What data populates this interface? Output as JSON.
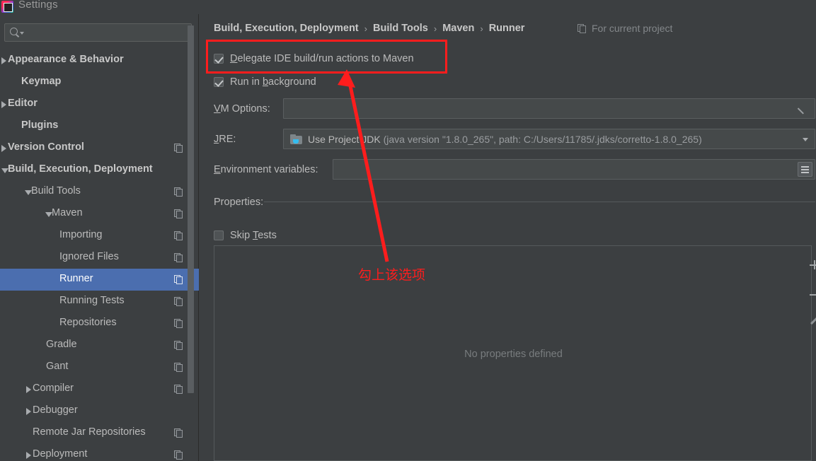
{
  "window": {
    "title": "Settings",
    "logo_icon": "intellij-idea-logo-icon"
  },
  "sidebar": {
    "search": {
      "value": "",
      "placeholder": "",
      "icon": "search-icon",
      "caret_icon": "chevron-down-icon"
    },
    "items": [
      {
        "label": "Appearance & Behavior",
        "indent": 11,
        "arrow": "right",
        "bold": true,
        "copy": false
      },
      {
        "label": "Keymap",
        "indent": 30,
        "arrow": "none",
        "bold": true,
        "copy": false
      },
      {
        "label": "Editor",
        "indent": 11,
        "arrow": "right",
        "bold": true,
        "copy": false
      },
      {
        "label": "Plugins",
        "indent": 30,
        "arrow": "none",
        "bold": true,
        "copy": false
      },
      {
        "label": "Version Control",
        "indent": 11,
        "arrow": "right",
        "bold": true,
        "copy": true
      },
      {
        "label": "Build, Execution, Deployment",
        "indent": 11,
        "arrow": "down",
        "bold": true,
        "copy": false
      },
      {
        "label": "Build Tools",
        "indent": 44,
        "arrow": "down",
        "bold": false,
        "copy": true
      },
      {
        "label": "Maven",
        "indent": 73,
        "arrow": "down",
        "bold": false,
        "copy": true
      },
      {
        "label": "Importing",
        "indent": 84,
        "arrow": "none",
        "bold": false,
        "copy": true
      },
      {
        "label": "Ignored Files",
        "indent": 84,
        "arrow": "none",
        "bold": false,
        "copy": true
      },
      {
        "label": "Runner",
        "indent": 84,
        "arrow": "none",
        "bold": false,
        "copy": true,
        "selected": true
      },
      {
        "label": "Running Tests",
        "indent": 84,
        "arrow": "none",
        "bold": false,
        "copy": true
      },
      {
        "label": "Repositories",
        "indent": 84,
        "arrow": "none",
        "bold": false,
        "copy": true
      },
      {
        "label": "Gradle",
        "indent": 65,
        "arrow": "none",
        "bold": false,
        "copy": true
      },
      {
        "label": "Gant",
        "indent": 65,
        "arrow": "none",
        "bold": false,
        "copy": true
      },
      {
        "label": "Compiler",
        "indent": 46,
        "arrow": "right",
        "bold": false,
        "copy": true
      },
      {
        "label": "Debugger",
        "indent": 46,
        "arrow": "right",
        "bold": false,
        "copy": false
      },
      {
        "label": "Remote Jar Repositories",
        "indent": 46,
        "arrow": "none",
        "bold": false,
        "copy": true
      },
      {
        "label": "Deployment",
        "indent": 46,
        "arrow": "right",
        "bold": false,
        "copy": true
      }
    ]
  },
  "main": {
    "breadcrumb": {
      "crumbs": [
        "Build, Execution, Deployment",
        "Build Tools",
        "Maven",
        "Runner"
      ],
      "separator": "›"
    },
    "for_project": {
      "label": "For current project",
      "icon": "copy-icon"
    },
    "delegate_checkbox": {
      "label_before": "",
      "mnemonic": "D",
      "label_after": "elegate IDE build/run actions to Maven",
      "checked": true
    },
    "background_checkbox": {
      "label_before": "Run in ",
      "mnemonic": "b",
      "label_after": "ackground",
      "checked": true
    },
    "vm_options": {
      "label_mnemonic": "V",
      "label_rest": "M Options:",
      "value": "",
      "expand_icon": "expand-arrows-icon"
    },
    "jre": {
      "label_mnemonic": "J",
      "label_rest": "RE:",
      "value_main": "Use Project JDK ",
      "value_dim": "(java version \"1.8.0_265\", path: C:/Users/11785/.jdks/corretto-1.8.0_265)",
      "folder_icon": "jdk-folder-icon",
      "caret_icon": "chevron-down-icon"
    },
    "environment_variables": {
      "label_mnemonic": "E",
      "label_rest": "nvironment variables:",
      "value": "",
      "browse_icon": "list-browse-icon"
    },
    "properties": {
      "label": "Properties:",
      "skip_tests": {
        "label_before": "Skip ",
        "mnemonic": "T",
        "label_after": "ests",
        "checked": false
      },
      "empty_text": "No properties defined",
      "toolbar": [
        {
          "name": "add-property-button",
          "icon": "plus-icon"
        },
        {
          "name": "remove-property-button",
          "icon": "minus-icon"
        },
        {
          "name": "edit-property-button",
          "icon": "pencil-icon"
        }
      ]
    }
  },
  "annotations": {
    "highlight_color": "#fe1d1d",
    "note_text": "勾上该选项",
    "arrow_icon": "red-arrow-icon",
    "box_target": "delegate-checkbox"
  },
  "colors": {
    "background": "#3c3f41",
    "selection": "#4b6eaf",
    "field_bg": "#45494a",
    "text": "#bbbbbb",
    "muted_text": "#83878a",
    "annotation": "#fe1d1d"
  }
}
